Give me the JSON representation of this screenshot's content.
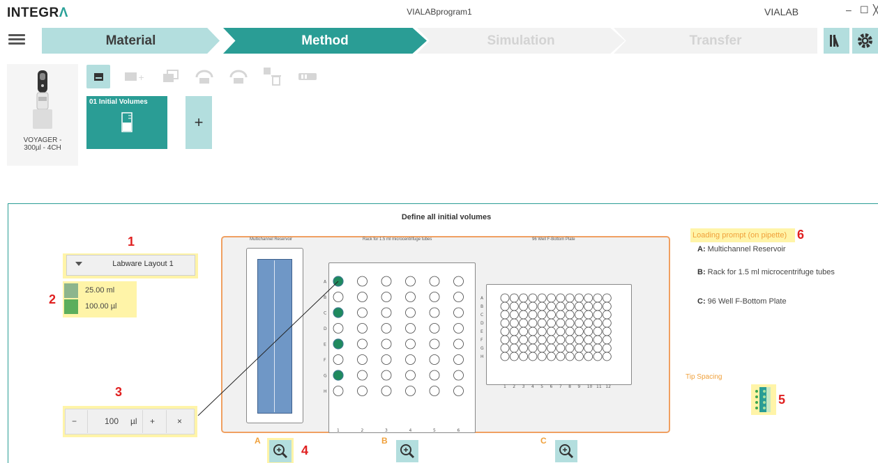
{
  "app": {
    "logo_text": "INTEGR",
    "logo_accent": "Λ",
    "window_title": "VIALABprogram1",
    "product": "VIALAB",
    "minimize_glyph": "–",
    "maximize_glyph": "☐",
    "close_glyph": "╳"
  },
  "workflow": {
    "steps": [
      {
        "label": "Material",
        "state": "completed"
      },
      {
        "label": "Method",
        "state": "active"
      },
      {
        "label": "Simulation",
        "state": "disabled"
      },
      {
        "label": "Transfer",
        "state": "disabled"
      }
    ]
  },
  "toolbar": {
    "tools": [
      "step-list-icon",
      "add-step-icon",
      "copy-step-icon",
      "undo-icon",
      "redo-icon",
      "delete-step-icon",
      "tip-box-icon"
    ]
  },
  "pipette": {
    "label": "VOYAGER -\n300µl - 4CH"
  },
  "method_steps": [
    {
      "title": "01 Initial Volumes"
    }
  ],
  "add_step_glyph": "+",
  "panel": {
    "title": "Define all initial volumes",
    "deck_labels": {
      "a": "Multichannel Reservoir",
      "b": "Rack for 1.5 ml microcentrifuge tubes",
      "c": "96 Well F-Bottom Plate"
    },
    "callouts": [
      "1",
      "2",
      "3",
      "4",
      "5",
      "6"
    ],
    "labware_layout": "Labware Layout 1",
    "volumes": [
      {
        "value": "25.00 ml",
        "color": "#8db58d"
      },
      {
        "value": "100.00 µl",
        "color": "#5cae5c"
      }
    ],
    "stepper": {
      "minus": "−",
      "value": "100",
      "unit": "µl",
      "plus": "+",
      "clear": "×"
    },
    "loading_prompt": "Loading prompt (on pipette)",
    "legend": [
      {
        "key": "A:",
        "text": "Multichannel Reservoir"
      },
      {
        "key": "B:",
        "text": "Rack for 1.5 ml microcentrifuge tubes"
      },
      {
        "key": "C:",
        "text": "96 Well F-Bottom Plate"
      }
    ],
    "tip_spacing": "Tip Spacing",
    "zoom_labels": [
      "A",
      "B",
      "C"
    ],
    "rack": {
      "rows": [
        "A",
        "B",
        "C",
        "D",
        "E",
        "F",
        "G",
        "H"
      ],
      "cols": [
        "1",
        "2",
        "3",
        "4",
        "5",
        "6"
      ],
      "filled": [
        "A1",
        "C1",
        "E1",
        "G1"
      ]
    },
    "plate": {
      "rows": [
        "A",
        "B",
        "C",
        "D",
        "E",
        "F",
        "G",
        "H"
      ],
      "cols": [
        "1",
        "2",
        "3",
        "4",
        "5",
        "6",
        "7",
        "8",
        "9",
        "10",
        "11",
        "12"
      ]
    }
  },
  "colors": {
    "accent": "#2a9d95",
    "accent_light": "#b3dede",
    "highlight": "#fff4a8",
    "callout": "#e02020",
    "orange": "#f0a061",
    "well_fill": "#1f8a5e"
  }
}
